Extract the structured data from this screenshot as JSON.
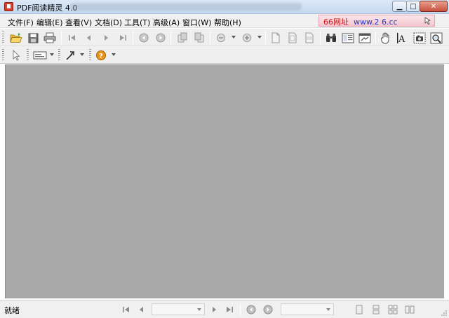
{
  "window": {
    "title": "PDF阅读精灵 4.0",
    "minimize_label": "▁",
    "maximize_label": "□",
    "close_label": "✕"
  },
  "menu": {
    "items": [
      {
        "label": "文件(F)"
      },
      {
        "label": "编辑(E)"
      },
      {
        "label": "查看(V)"
      },
      {
        "label": "文档(D)"
      },
      {
        "label": "工具(T)"
      },
      {
        "label": "高级(A)"
      },
      {
        "label": "窗口(W)"
      },
      {
        "label": "帮助(H)"
      }
    ]
  },
  "ad": {
    "prefix": "66网址",
    "url_part1": "www.2",
    "url_part2": "6.cc"
  },
  "toolbar_icons": [
    "open-folder-icon",
    "save-icon",
    "print-icon",
    "first-page-icon",
    "previous-page-icon",
    "next-page-icon",
    "last-page-icon",
    "go-back-icon",
    "go-forward-icon",
    "rotate-left-icon",
    "rotate-right-icon",
    "zoom-out-icon",
    "zoom-in-icon",
    "actual-size-icon",
    "fit-page-icon",
    "fit-width-icon",
    "find-icon",
    "single-page-view-icon",
    "continuous-view-icon",
    "hand-tool-icon",
    "text-select-icon",
    "snapshot-icon",
    "magnifier-icon",
    "pointer-icon",
    "annotation-icon",
    "link-tool-icon",
    "help-icon"
  ],
  "status": {
    "text": "就绪"
  },
  "colors": {
    "document_background": "#a8a8a8",
    "chrome": "#efefef",
    "ad_red": "#d01818",
    "ad_blue": "#1c3cc8",
    "help_orange": "#e8951a"
  }
}
